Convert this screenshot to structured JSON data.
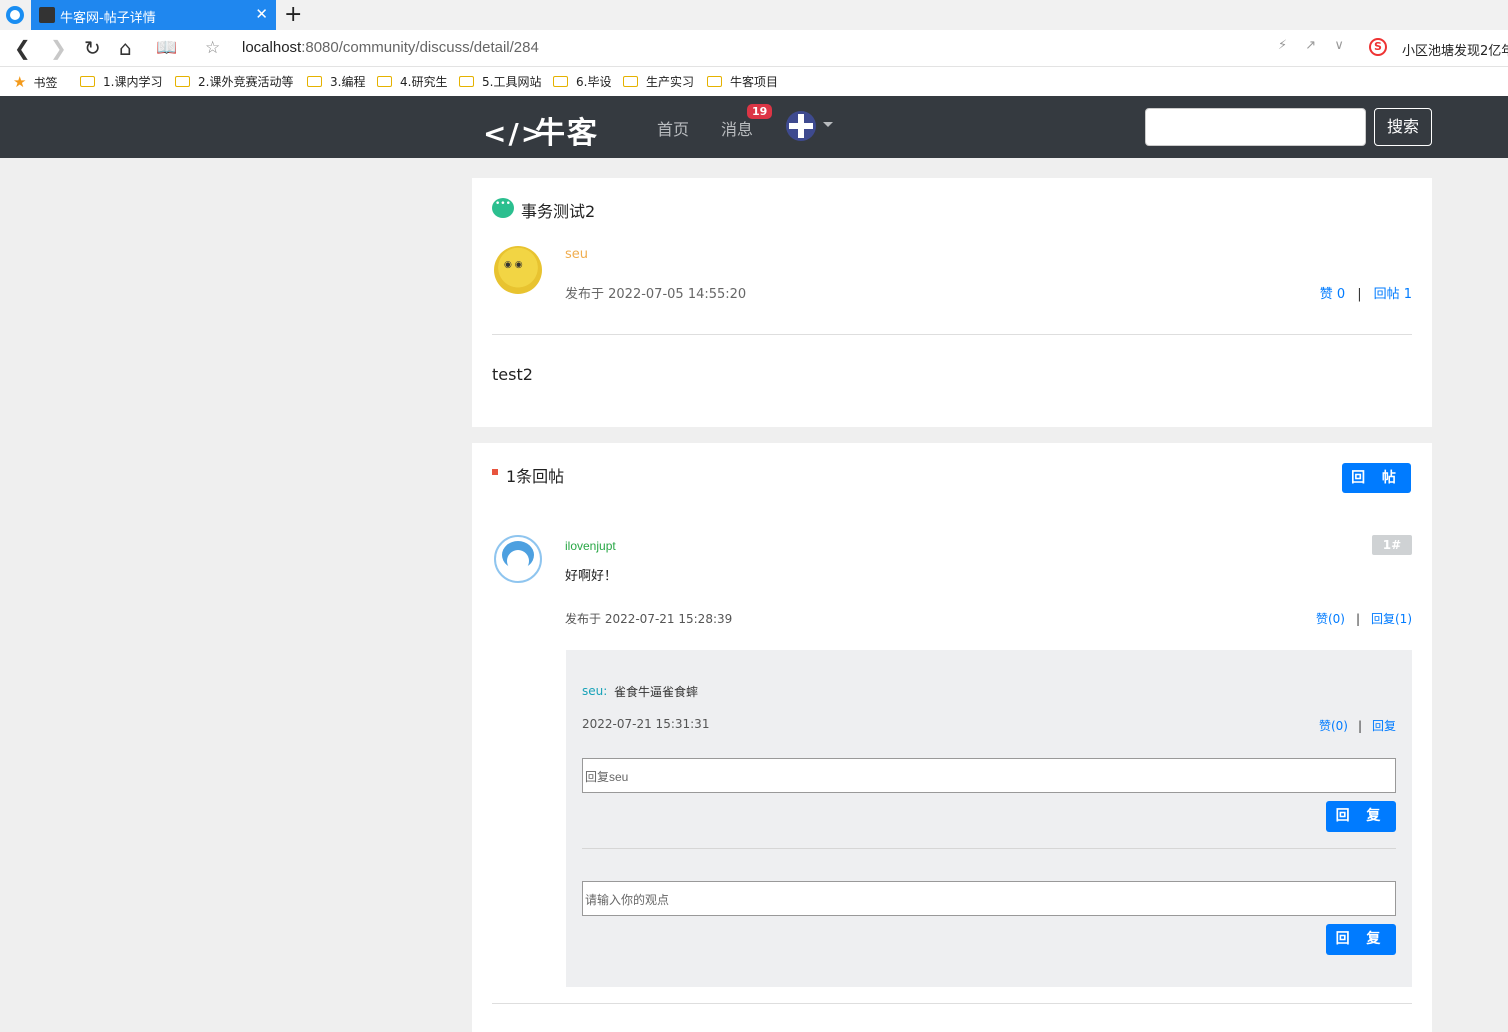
{
  "browser": {
    "tab_title": "牛客网-帖子详情",
    "close_glyph": "✕",
    "new_tab_glyph": "+",
    "url_host": "localhost",
    "url_rest": ":8080/community/discuss/detail/284",
    "news_text": "小区池塘发现2亿年",
    "bookmarks_label": "书签",
    "bookmarks": [
      {
        "label": "1.课内学习"
      },
      {
        "label": "2.课外竞赛活动等"
      },
      {
        "label": "3.编程"
      },
      {
        "label": "4.研究生"
      },
      {
        "label": "5.工具网站"
      },
      {
        "label": "6.毕设"
      },
      {
        "label": "生产实习"
      },
      {
        "label": "牛客项目"
      }
    ]
  },
  "header": {
    "logo_text": "牛客",
    "nav_home": "首页",
    "nav_messages": "消息",
    "message_count": "19",
    "search_button": "搜索"
  },
  "post": {
    "title": "事务测试2",
    "author": "seu",
    "time": "发布于 2022-07-05 14:55:20",
    "like": "赞 0",
    "reply": "回帖 1",
    "content": "test2"
  },
  "replies": {
    "count_label": "1条回帖",
    "reply_button": "回 帖",
    "comment": {
      "user": "ilovenjupt",
      "floor": "1#",
      "text": "好啊好！",
      "time": "发布于 2022-07-21 15:28:39",
      "like": "赞(0)",
      "reply": "回复(1)",
      "sub_reply": {
        "user": "seu:",
        "text": "雀食牛逼雀食蟀",
        "time": "2022-07-21 15:31:31",
        "like": "赞(0)",
        "reply": "回复"
      },
      "sub_reply_placeholder": "回复seu",
      "sub_reply_button": "回 复",
      "opinion_placeholder": "请输入你的观点",
      "opinion_button": "回 复"
    }
  },
  "colors": {
    "accent": "#007bff",
    "header_bg": "#353a40",
    "tab_blue": "#1f87ef",
    "author_name": "#f0ad4e",
    "commenter_name": "#28a745"
  }
}
